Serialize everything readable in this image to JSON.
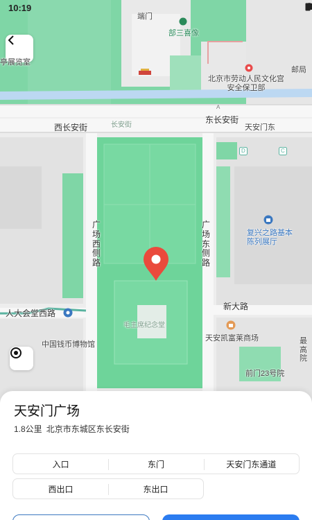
{
  "status_bar": {
    "time": "10:19"
  },
  "map": {
    "roads": {
      "west_chang_an": "西长安街",
      "east_chang_an": "东长安街",
      "chang_an_inner": "长安街",
      "guangchang_west": "广场西侧路",
      "guangchang_east": "广场东侧路",
      "renda_west": "人大会堂西路",
      "xin_da": "新大路"
    },
    "pois": {
      "duanmen": "端门",
      "labor_culture_palace": "北京市劳动人民文化宫安全保卫部",
      "tiananmen_east": "天安门东",
      "fuxing_road_exhibit": "复兴之路基本陈列展厅",
      "mausoleum": "毛主席纪念堂",
      "national_money_museum": "中国钱币博物馆",
      "kaileifu": "天安凯富莱商场",
      "qianmen_23": "前门23号院",
      "zui_gao": "最高院",
      "partial_top_left": "亭展览室",
      "partial_top_right": "邮局",
      "hq_label": "部三喜像"
    },
    "markers": {
      "metro_d": "D",
      "metro_c": "C",
      "metro_a": "A"
    }
  },
  "place": {
    "name": "天安门广场",
    "distance": "1.8公里",
    "address": "北京市东城区东长安街"
  },
  "entrances": {
    "row1": [
      "入口",
      "东门",
      "天安门东通道"
    ],
    "row2": [
      "西出口",
      "东出口"
    ]
  },
  "colors": {
    "accent_blue": "#2b7cf0",
    "pin_red": "#ea4a3c",
    "park_green": "#5ec98f",
    "map_gray": "#ededed"
  },
  "icons": {
    "back": "chevron-left-icon",
    "locate": "locate-icon",
    "pin": "location-pin-icon"
  }
}
